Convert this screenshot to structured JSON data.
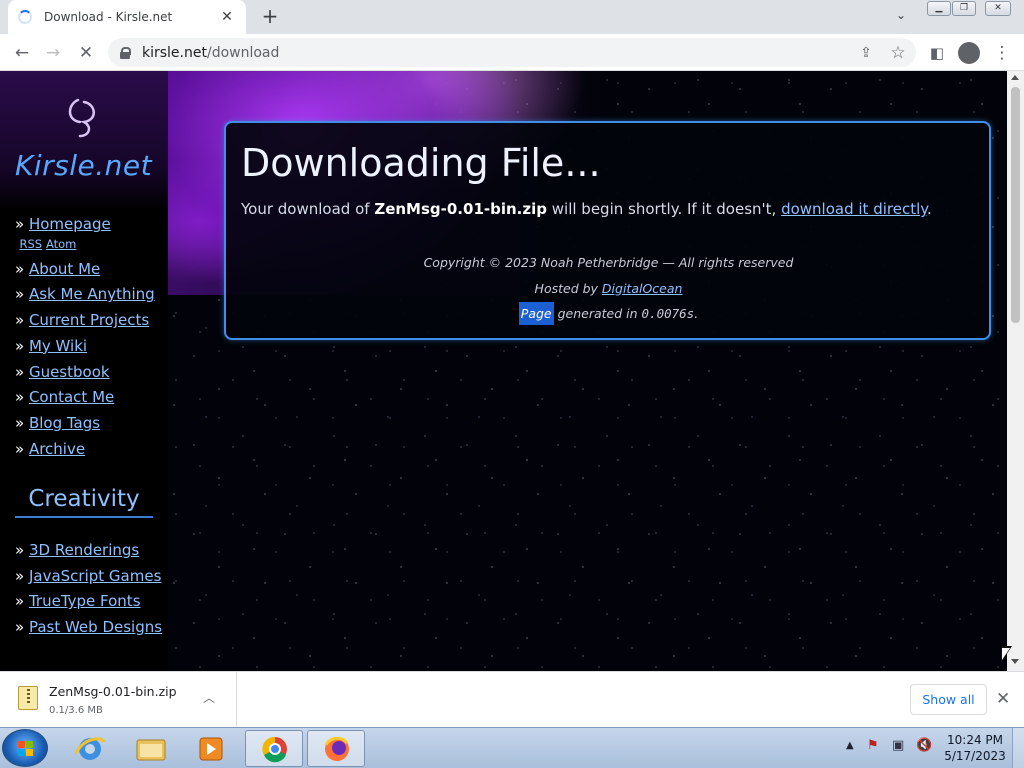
{
  "browser": {
    "tab_title": "Download - Kirsle.net",
    "url_domain": "kirsle.net",
    "url_path": "/download"
  },
  "sidebar": {
    "logo_text": "Kirsle.net",
    "nav_items": [
      {
        "label": "Homepage"
      },
      {
        "label": "About Me"
      },
      {
        "label": "Ask Me Anything"
      },
      {
        "label": "Current Projects"
      },
      {
        "label": "My Wiki"
      },
      {
        "label": "Guestbook"
      },
      {
        "label": "Contact Me"
      },
      {
        "label": "Blog Tags"
      },
      {
        "label": "Archive"
      }
    ],
    "rss_label": "RSS",
    "atom_label": "Atom",
    "creativity_heading": "Creativity",
    "creativity_items": [
      {
        "label": "3D Renderings"
      },
      {
        "label": "JavaScript Games"
      },
      {
        "label": "TrueType Fonts"
      },
      {
        "label": "Past Web Designs"
      }
    ],
    "link_color": "#8fc0ff"
  },
  "main": {
    "heading": "Downloading File...",
    "message_prefix": "Your download of ",
    "file_name": "ZenMsg-0.01-bin.zip",
    "message_middle": " will begin shortly. If it doesn't, ",
    "direct_link": "download it directly",
    "message_suffix": ".",
    "copyright": "Copyright © 2023 Noah Petherbridge — All rights reserved",
    "hosted_prefix": "Hosted by ",
    "hosted_link": "DigitalOcean",
    "gen_highlight": "Page",
    "gen_middle": " generated in ",
    "gen_time": "0.0076s",
    "gen_suffix": ".",
    "border_color": "#3f8fe8"
  },
  "download_shelf": {
    "file_name": "ZenMsg-0.01-bin.zip",
    "progress": "0.1/3.6 MB",
    "show_all_label": "Show all"
  },
  "taskbar": {
    "time": "10:24 PM",
    "date": "5/17/2023",
    "icons": [
      "start-orb",
      "internet-explorer-icon",
      "file-explorer-icon",
      "media-player-icon",
      "chrome-icon",
      "firefox-icon"
    ]
  }
}
